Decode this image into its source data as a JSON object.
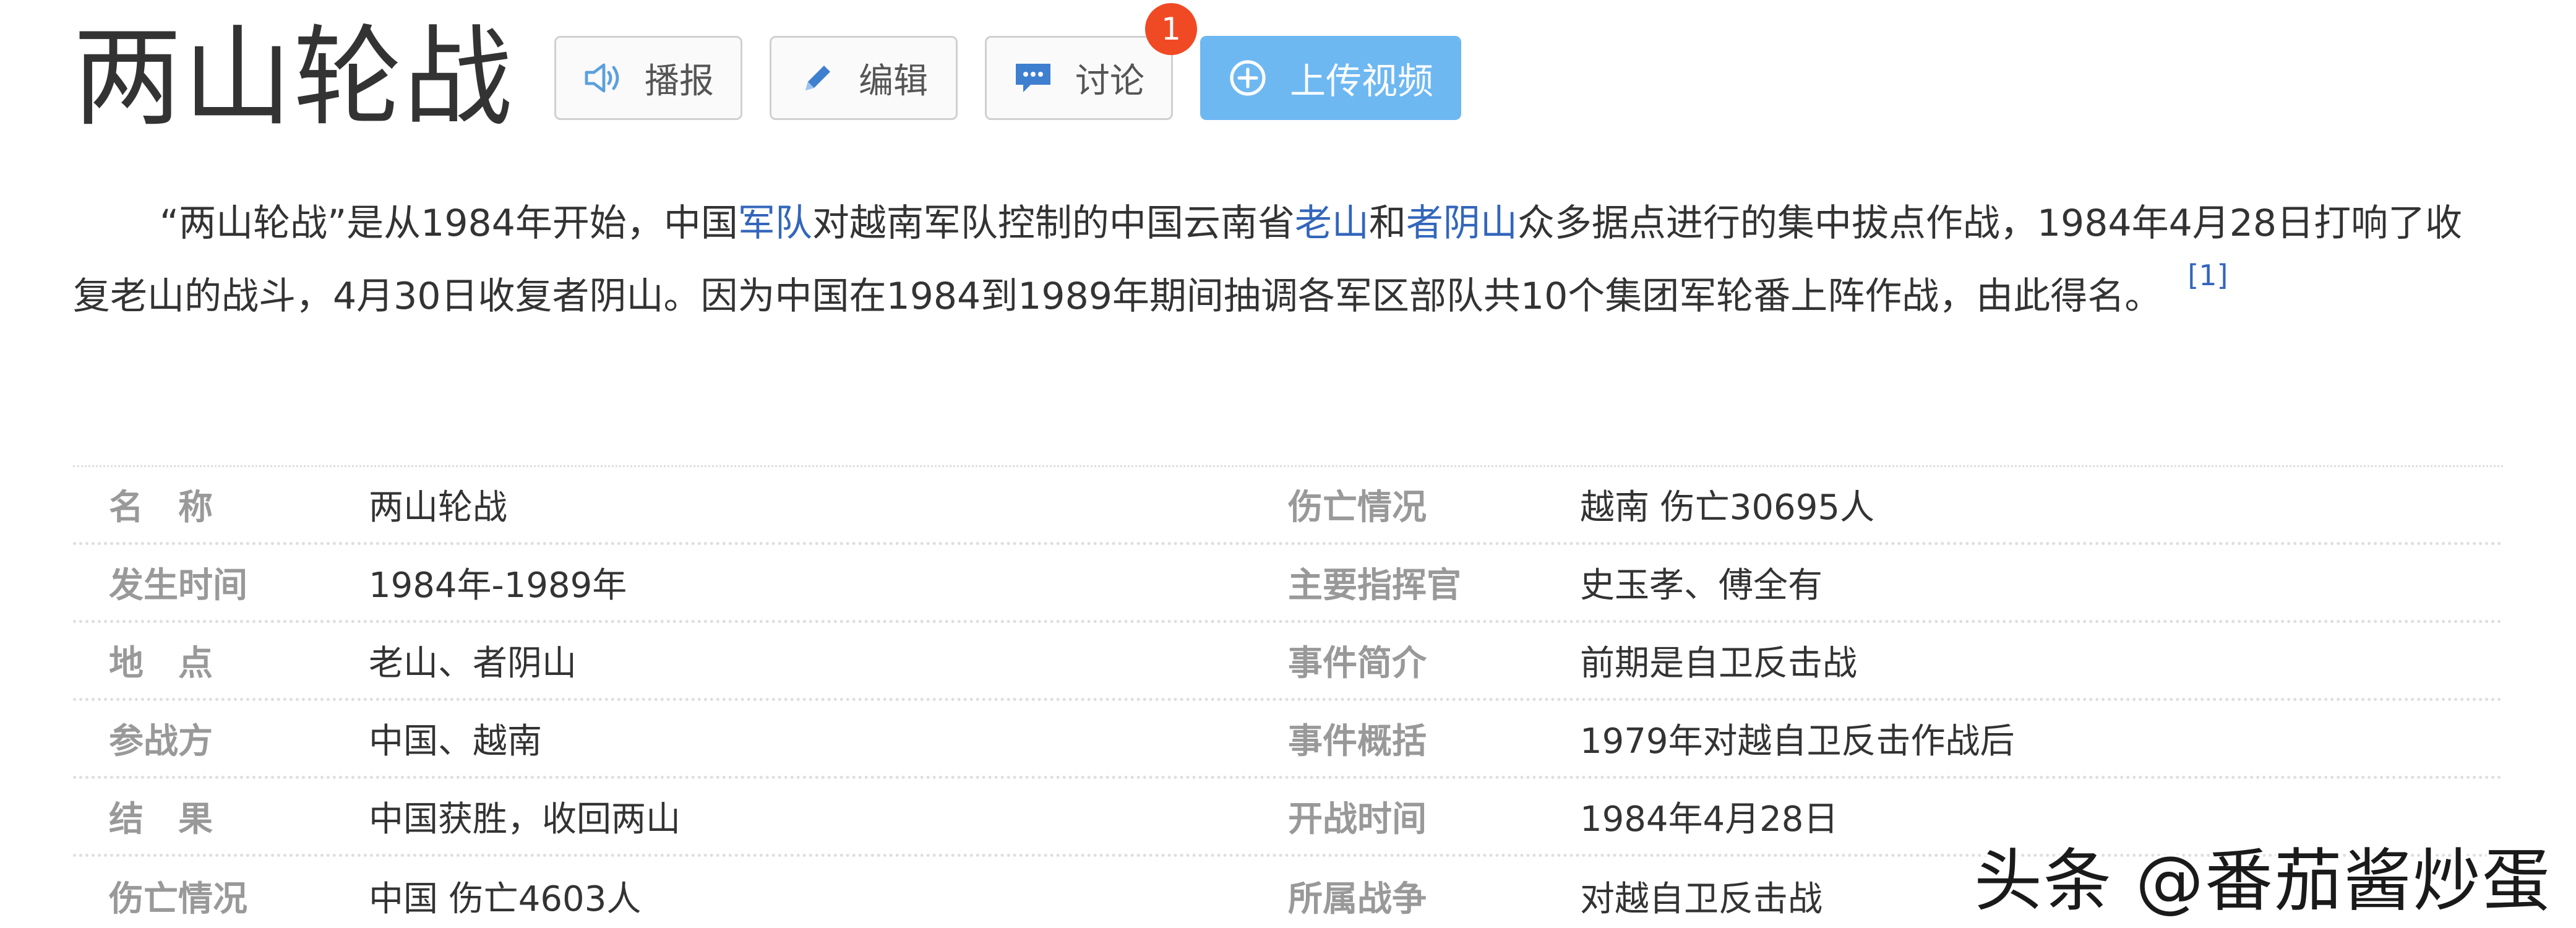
{
  "header": {
    "title": "两山轮战",
    "buttons": {
      "play": {
        "label": "播报",
        "icon": "speaker-icon"
      },
      "edit": {
        "label": "编辑",
        "icon": "pencil-icon"
      },
      "discuss": {
        "label": "讨论",
        "icon": "chat-bubble-icon",
        "badge": "1"
      },
      "upload": {
        "label": "上传视频",
        "icon": "plus-circle-icon"
      }
    }
  },
  "summary": {
    "t1": "“两山轮战”是从1984年开始，中国",
    "link_army": "军队",
    "t2": "对越南军队控制的中国云南省",
    "link_laoshan": "老山",
    "t3": "和",
    "link_zheyinshan": "者阴山",
    "t4": "众多据点进行的集中拔点作战，1984年4月28日打响了收复老山的战斗，4月30日收复者阴山。因为中国在1984到1989年期间抽调各军区部队共10个集团军轮番上阵作战，由此得名。",
    "ref": "[1]"
  },
  "infobox": {
    "rows": [
      {
        "l_label": "名　称",
        "l_value": "两山轮战",
        "r_label": "伤亡情况",
        "r_value": "越南 伤亡30695人"
      },
      {
        "l_label": "发生时间",
        "l_value": "1984年-1989年",
        "r_label": "主要指挥官",
        "r_value": "史玉孝、傅全有"
      },
      {
        "l_label": "地　点",
        "l_value": "老山、者阴山",
        "r_label": "事件简介",
        "r_value": "前期是自卫反击战"
      },
      {
        "l_label": "参战方",
        "l_value": "中国、越南",
        "r_label": "事件概括",
        "r_value": "1979年对越自卫反击作战后"
      },
      {
        "l_label": "结　果",
        "l_value": "中国获胜，收回两山",
        "r_label": "开战时间",
        "r_value": "1984年4月28日"
      },
      {
        "l_label": "伤亡情况",
        "l_value": "中国 伤亡4603人",
        "r_label": "所属战争",
        "r_value": "对越自卫反击战"
      }
    ]
  },
  "watermark": "头条 @番茄酱炒蛋",
  "colors": {
    "link": "#3366bb",
    "upload_button": "#6eb8f2",
    "badge": "#f04a24",
    "label": "#999999"
  }
}
